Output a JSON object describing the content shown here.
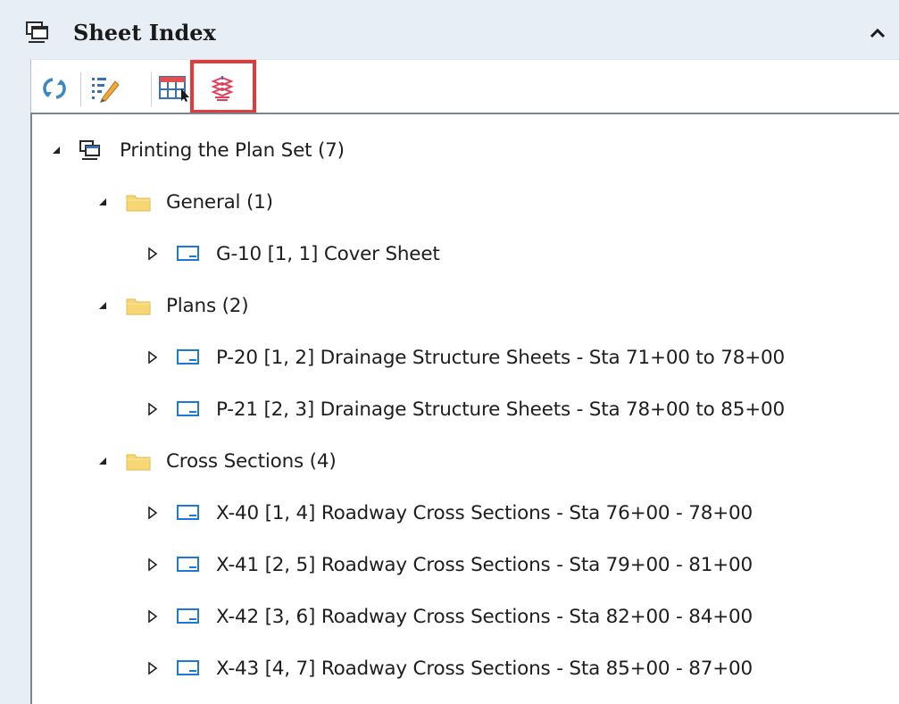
{
  "panel": {
    "title": "Sheet Index",
    "header_icon": "sheet-index-icon",
    "collapse_icon": "chevron-up-icon"
  },
  "toolbar": {
    "buttons": [
      {
        "name": "refresh-button",
        "icon": "refresh-icon"
      },
      {
        "name": "edit-properties-button",
        "icon": "edit-list-icon"
      },
      {
        "name": "table-view-button",
        "icon": "table-icon"
      },
      {
        "name": "print-organizer-button",
        "icon": "print-stack-icon",
        "highlighted": true
      }
    ],
    "highlight_color": "#e03a3a"
  },
  "tree": {
    "root": {
      "label": "Printing the Plan Set (7)",
      "icon": "sheet-index-icon",
      "expanded": true
    },
    "folders": [
      {
        "label": "General (1)",
        "icon": "folder-icon",
        "expanded": true,
        "sheets": [
          {
            "label": "G-10 [1, 1] Cover Sheet",
            "icon": "sheet-icon"
          }
        ]
      },
      {
        "label": "Plans (2)",
        "icon": "folder-icon",
        "expanded": true,
        "sheets": [
          {
            "label": "P-20 [1, 2] Drainage Structure Sheets - Sta 71+00 to 78+00",
            "icon": "sheet-icon"
          },
          {
            "label": "P-21 [2, 3] Drainage Structure Sheets - Sta 78+00 to 85+00",
            "icon": "sheet-icon"
          }
        ]
      },
      {
        "label": "Cross Sections (4)",
        "icon": "folder-icon",
        "expanded": true,
        "sheets": [
          {
            "label": "X-40 [1, 4] Roadway Cross Sections - Sta 76+00 - 78+00",
            "icon": "sheet-icon"
          },
          {
            "label": "X-41 [2, 5] Roadway Cross Sections - Sta 79+00 - 81+00",
            "icon": "sheet-icon"
          },
          {
            "label": "X-42 [3, 6] Roadway Cross Sections - Sta 82+00 - 84+00",
            "icon": "sheet-icon"
          },
          {
            "label": "X-43 [4, 7] Roadway Cross Sections - Sta 85+00 - 87+00",
            "icon": "sheet-icon"
          }
        ]
      }
    ]
  },
  "colors": {
    "panel_bg": "#e8eef6",
    "folder": "#f7d774",
    "sheet_icon": "#1e78d6",
    "border": "#7a8592"
  }
}
